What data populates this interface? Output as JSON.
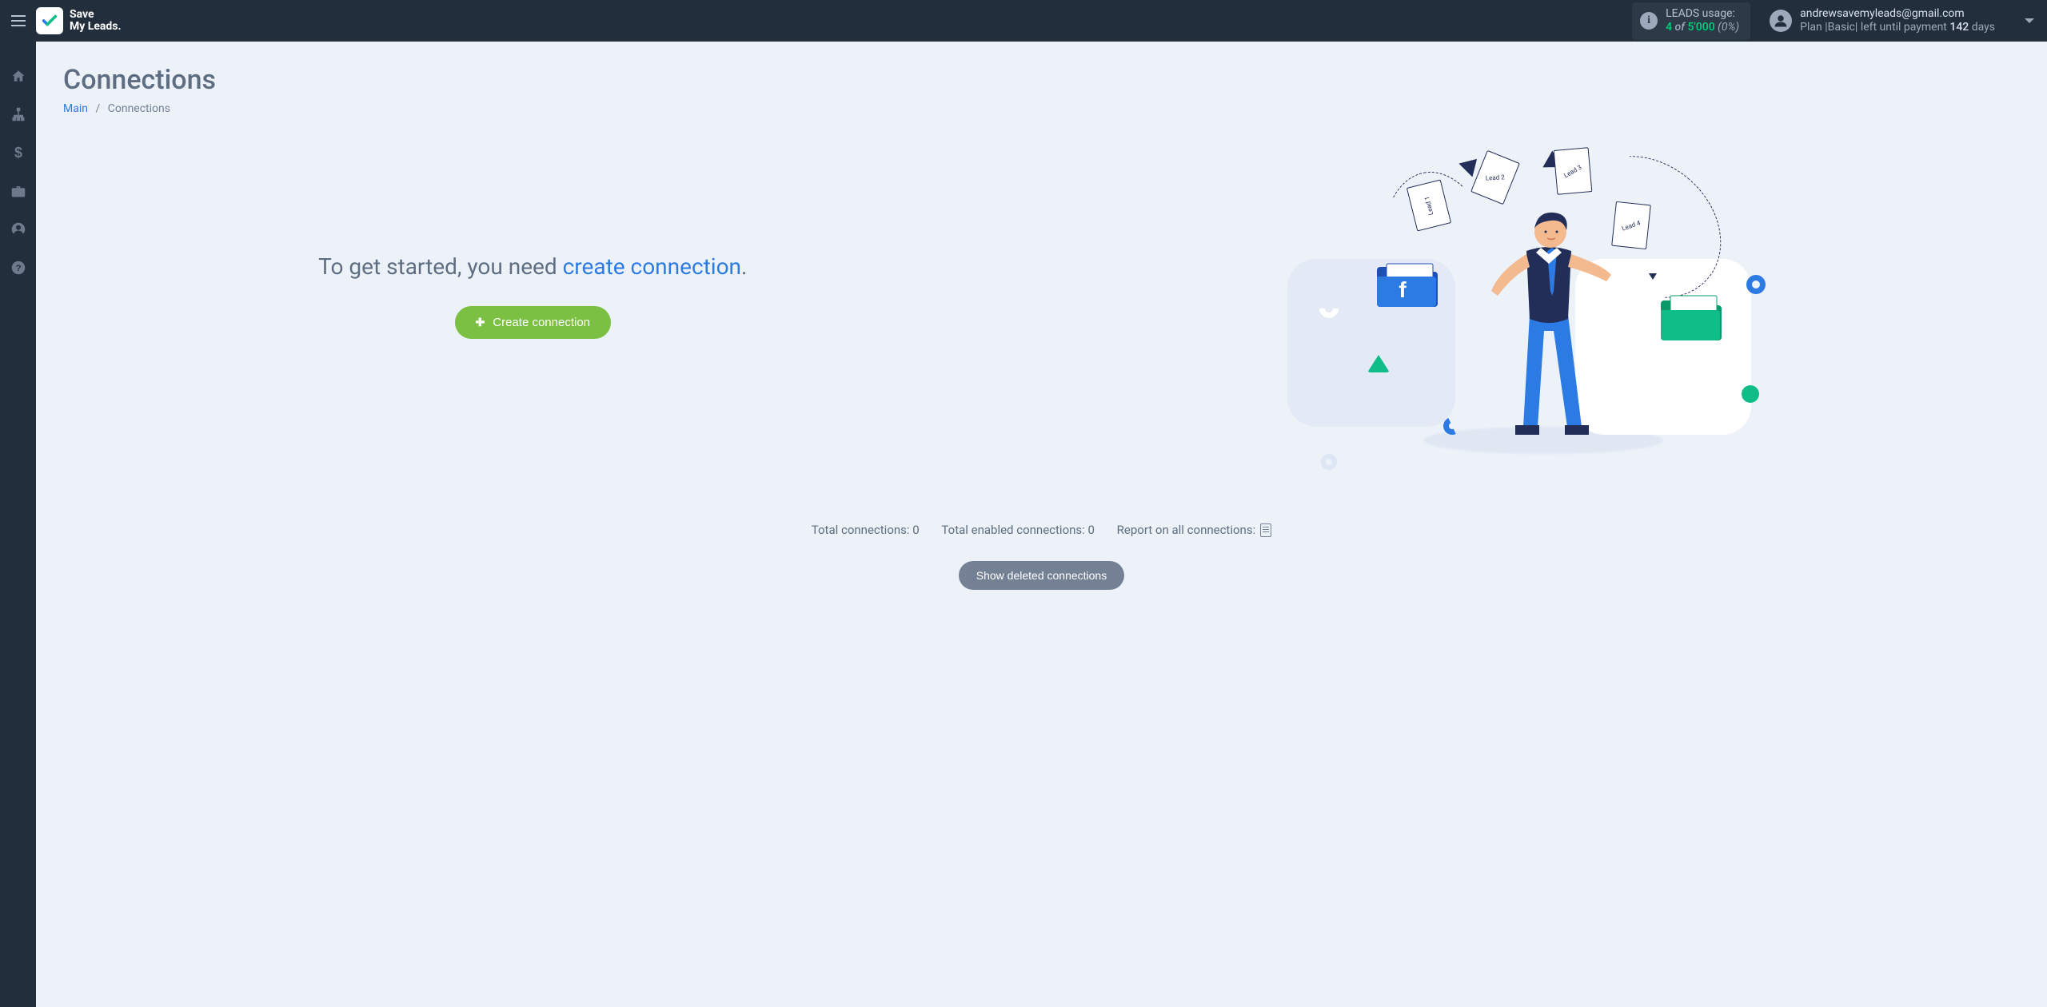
{
  "brand": {
    "line1": "Save",
    "line2": "My Leads."
  },
  "leadsUsage": {
    "label": "LEADS usage:",
    "used": "4",
    "of": "of",
    "limit": "5'000",
    "percent": "(0%)"
  },
  "user": {
    "email": "andrewsavemyleads@gmail.com",
    "planPrefix": "Plan |",
    "planName": "Basic",
    "planMid": "| left until payment",
    "daysLeft": "142",
    "daysLabel": "days"
  },
  "page": {
    "title": "Connections",
    "breadcrumb": {
      "main": "Main",
      "current": "Connections"
    }
  },
  "cta": {
    "line1": "To get started, you need ",
    "link": "create connection",
    "dot": ".",
    "button": "Create connection"
  },
  "illustration": {
    "doc1": "Lead 1",
    "doc2": "Lead 2",
    "doc3": "Lead 3",
    "doc4": "Lead 4"
  },
  "stats": {
    "total": "Total connections: 0",
    "enabled": "Total enabled connections: 0",
    "report": "Report on all connections:"
  },
  "buttons": {
    "showDeleted": "Show deleted connections"
  }
}
